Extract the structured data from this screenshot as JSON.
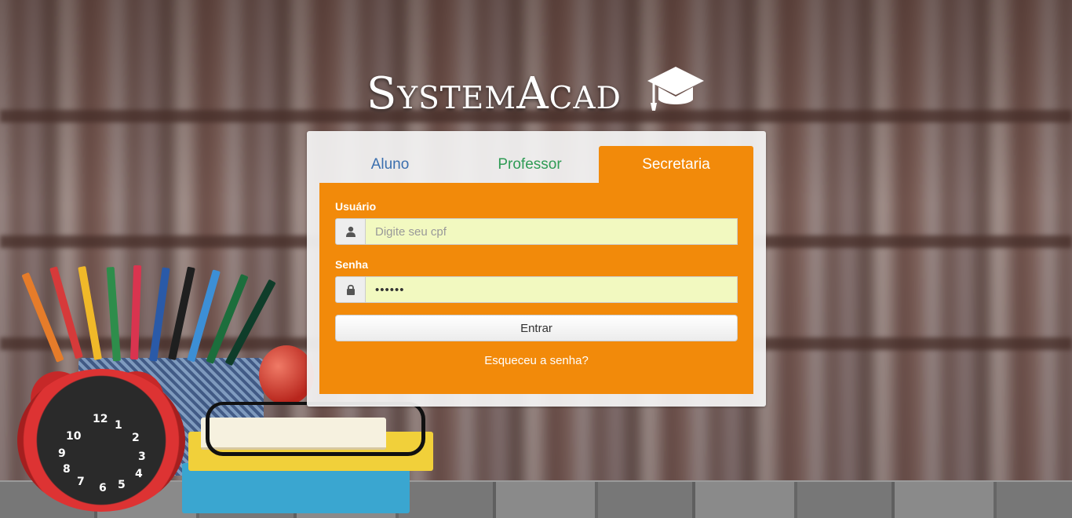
{
  "app": {
    "title": "SystemAcad",
    "icon": "graduation-cap-icon"
  },
  "tabs": [
    {
      "label": "Aluno",
      "color": "#3b6fae",
      "active": false
    },
    {
      "label": "Professor",
      "color": "#2f9b55",
      "active": false
    },
    {
      "label": "Secretaria",
      "color": "#ffffff",
      "active": true
    }
  ],
  "form": {
    "username_label": "Usuário",
    "username_placeholder": "Digite seu cpf",
    "username_value": "",
    "username_icon": "user-icon",
    "password_label": "Senha",
    "password_value": "••••••",
    "password_icon": "lock-icon",
    "submit_label": "Entrar",
    "forgot_label": "Esqueceu a senha?"
  },
  "colors": {
    "accent": "#f28a0a",
    "input_bg": "#f2f9c0"
  },
  "background": {
    "clock_numbers": [
      "12",
      "1",
      "2",
      "3",
      "4",
      "5",
      "6",
      "7",
      "8",
      "9",
      "10"
    ]
  }
}
